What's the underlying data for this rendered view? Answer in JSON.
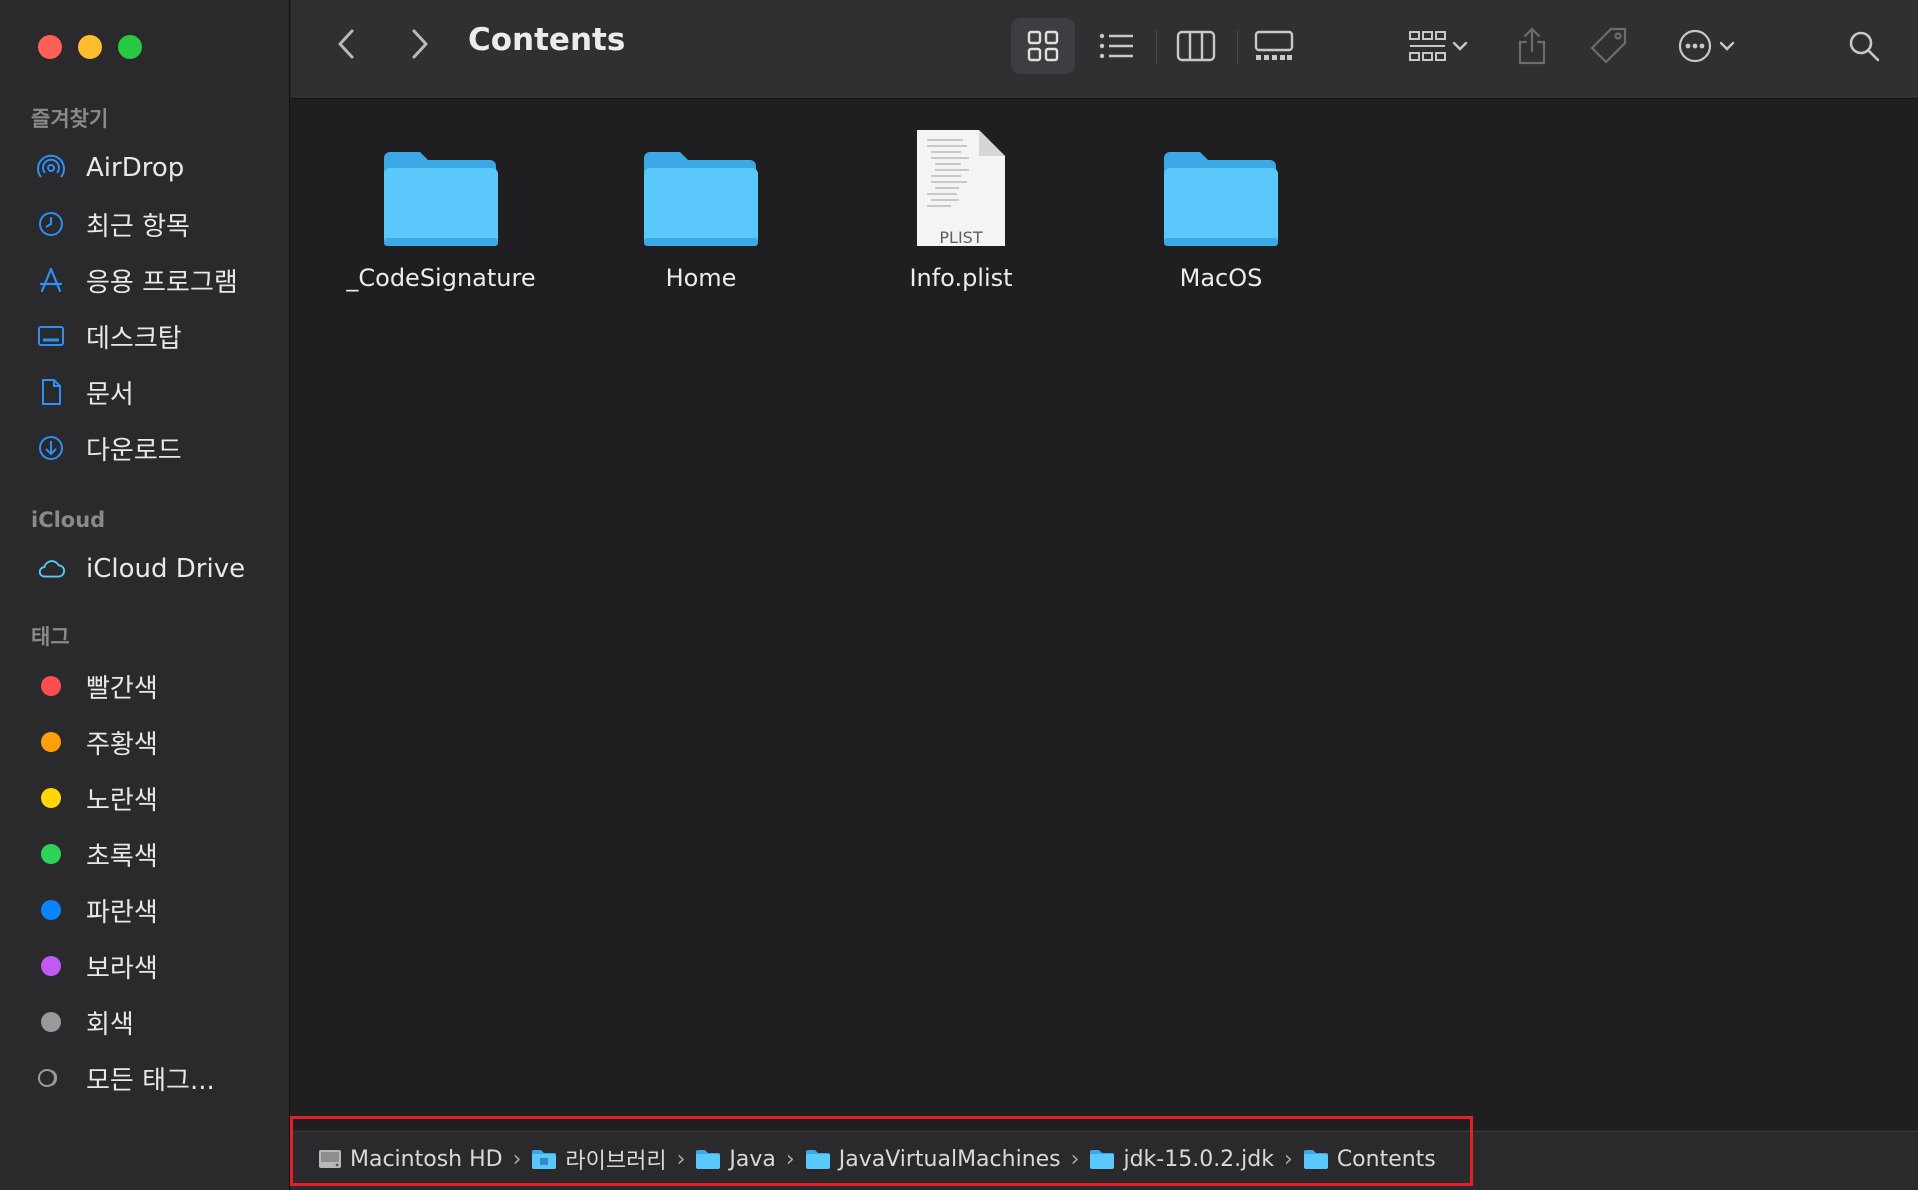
{
  "window": {
    "title": "Contents"
  },
  "sidebar": {
    "favorites_heading": "즐겨찾기",
    "favorites": [
      {
        "label": "AirDrop",
        "icon": "airdrop-icon"
      },
      {
        "label": "최근 항목",
        "icon": "clock-icon"
      },
      {
        "label": "응용 프로그램",
        "icon": "applications-icon"
      },
      {
        "label": "데스크탑",
        "icon": "desktop-icon"
      },
      {
        "label": "문서",
        "icon": "document-icon"
      },
      {
        "label": "다운로드",
        "icon": "download-icon"
      }
    ],
    "icloud_heading": "iCloud",
    "icloud": [
      {
        "label": "iCloud Drive",
        "icon": "cloud-icon"
      }
    ],
    "tags_heading": "태그",
    "tags": [
      {
        "label": "빨간색",
        "color": "#fe4d4d"
      },
      {
        "label": "주황색",
        "color": "#ff9f0a"
      },
      {
        "label": "노란색",
        "color": "#ffd60a"
      },
      {
        "label": "초록색",
        "color": "#30d158"
      },
      {
        "label": "파란색",
        "color": "#0a84ff"
      },
      {
        "label": "보라색",
        "color": "#bf5af2"
      },
      {
        "label": "회색",
        "color": "#98989d"
      },
      {
        "label": "모든 태그...",
        "color": ""
      }
    ]
  },
  "files": [
    {
      "name": "_CodeSignature",
      "type": "folder"
    },
    {
      "name": "Home",
      "type": "folder"
    },
    {
      "name": "Info.plist",
      "type": "plist",
      "badge": "PLIST"
    },
    {
      "name": "MacOS",
      "type": "folder"
    }
  ],
  "pathbar": {
    "items": [
      {
        "label": "Macintosh HD",
        "icon": "drive-icon"
      },
      {
        "label": "라이브러리",
        "icon": "library-folder-icon"
      },
      {
        "label": "Java",
        "icon": "folder-icon"
      },
      {
        "label": "JavaVirtualMachines",
        "icon": "folder-icon"
      },
      {
        "label": "jdk-15.0.2.jdk",
        "icon": "folder-icon"
      },
      {
        "label": "Contents",
        "icon": "folder-icon"
      }
    ],
    "separator": "›"
  },
  "colors": {
    "accent": "#2f8ff5",
    "folder": "#5ac8fa",
    "highlight": "#e3202a"
  }
}
